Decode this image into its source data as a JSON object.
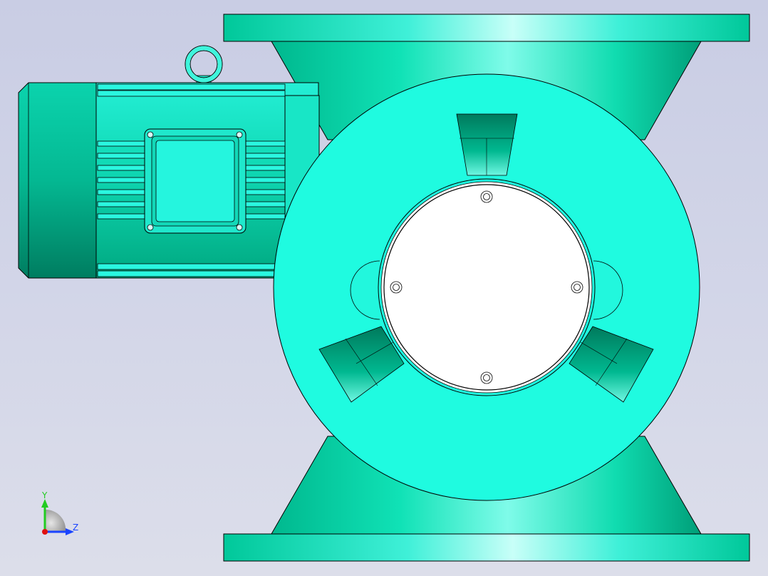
{
  "viewport": {
    "background_top": "#c9cde4",
    "background_bottom": "#dcdeea"
  },
  "model": {
    "body_color": "#1ef5dd",
    "shade_color": "#00c89a",
    "highlight_color": "#a8fff4",
    "cover_color": "#ffffff",
    "outline_color": "#000000",
    "parts": [
      "motor-fan-cover",
      "motor-body",
      "terminal-box",
      "lifting-eye",
      "upper-flange",
      "upper-hopper",
      "valve-housing",
      "end-cover",
      "lower-hopper",
      "lower-flange"
    ]
  },
  "triad": {
    "y_label": "Y",
    "z_label": "Z",
    "y_color": "#22cc22",
    "z_color": "#1a44ff",
    "x_color": "#e01010"
  }
}
